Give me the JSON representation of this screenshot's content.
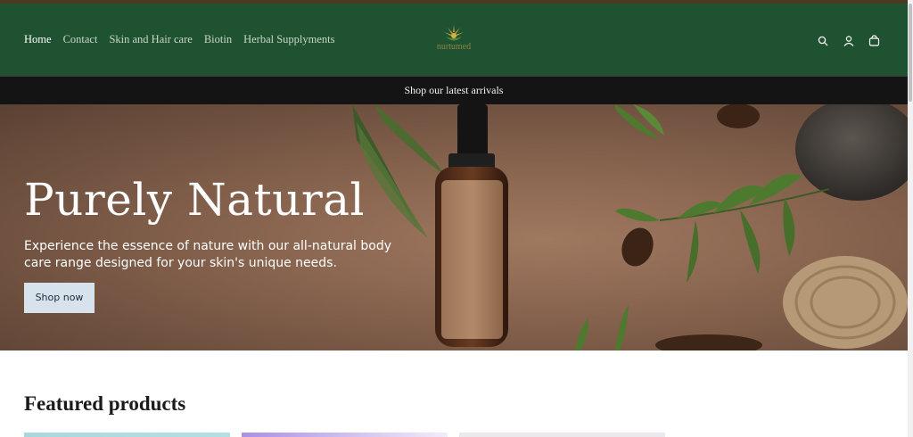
{
  "nav": {
    "items": [
      {
        "label": "Home",
        "active": true
      },
      {
        "label": "Contact",
        "active": false
      },
      {
        "label": "Skin and Hair care",
        "active": false
      },
      {
        "label": "Biotin",
        "active": false
      },
      {
        "label": "Herbal Supplyments",
        "active": false
      }
    ]
  },
  "logo": {
    "text": "nurtumed"
  },
  "header_icons": [
    "search-icon",
    "account-icon",
    "cart-icon"
  ],
  "announcement": {
    "text": "Shop our latest arrivals"
  },
  "hero": {
    "title": "Purely Natural",
    "description": "Experience the essence of nature with our all-natural body care range designed for your skin's unique needs.",
    "button_label": "Shop now"
  },
  "featured": {
    "title": "Featured products"
  },
  "colors": {
    "header_bg": "#1e5230",
    "announce_bg": "#141414",
    "button_bg": "#d8e2ec"
  }
}
